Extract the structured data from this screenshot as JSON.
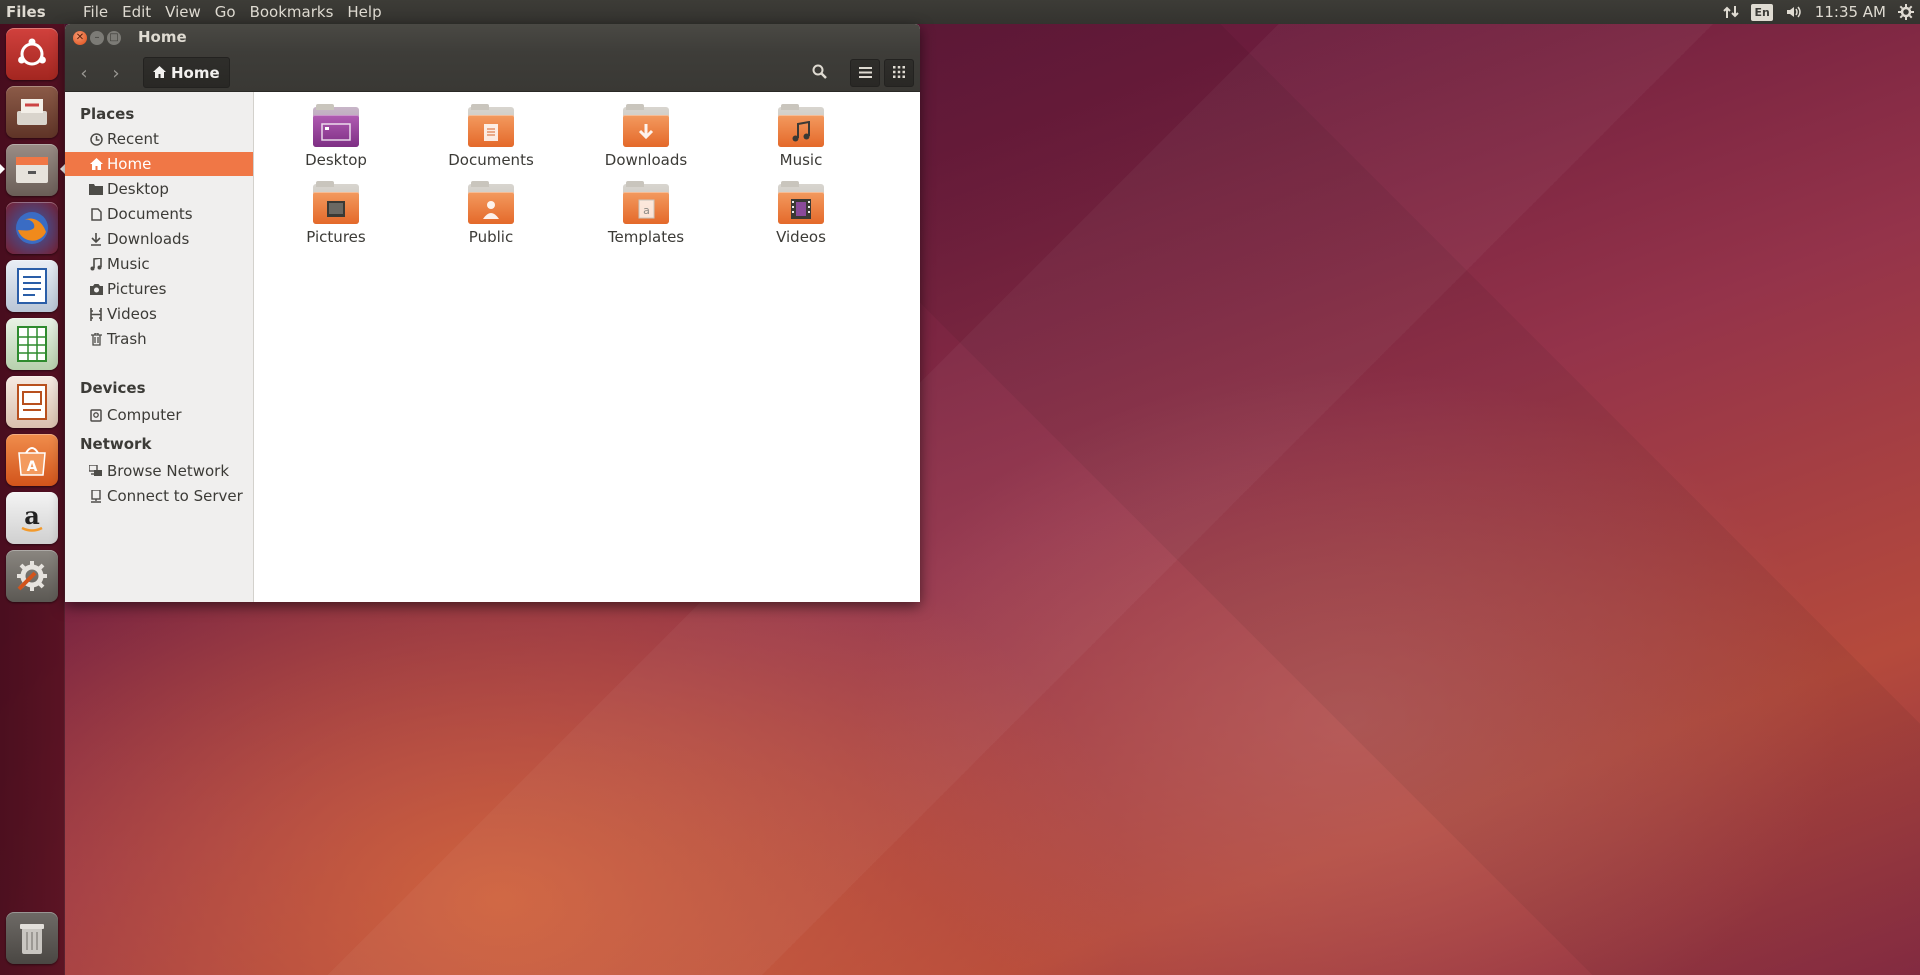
{
  "topbar": {
    "app_name": "Files",
    "menu": [
      "File",
      "Edit",
      "View",
      "Go",
      "Bookmarks",
      "Help"
    ],
    "keyboard_layout": "En",
    "clock": "11:35 AM"
  },
  "launcher": {
    "icons": [
      "ubuntu-dash-icon",
      "system-installer-icon",
      "files-icon",
      "firefox-icon",
      "libreoffice-writer-icon",
      "libreoffice-calc-icon",
      "libreoffice-impress-icon",
      "ubuntu-software-center-icon",
      "amazon-icon",
      "system-settings-icon",
      "trash-icon"
    ]
  },
  "window": {
    "title": "Home",
    "path_button": "Home"
  },
  "sidebar": {
    "places_header": "Places",
    "places": [
      {
        "label": "Recent",
        "icon": "clock-icon"
      },
      {
        "label": "Home",
        "icon": "home-icon",
        "active": true
      },
      {
        "label": "Desktop",
        "icon": "folder-icon"
      },
      {
        "label": "Documents",
        "icon": "document-icon"
      },
      {
        "label": "Downloads",
        "icon": "download-icon"
      },
      {
        "label": "Music",
        "icon": "music-icon"
      },
      {
        "label": "Pictures",
        "icon": "camera-icon"
      },
      {
        "label": "Videos",
        "icon": "film-icon"
      },
      {
        "label": "Trash",
        "icon": "trash-icon"
      }
    ],
    "devices_header": "Devices",
    "devices": [
      {
        "label": "Computer",
        "icon": "computer-icon"
      }
    ],
    "network_header": "Network",
    "network": [
      {
        "label": "Browse Network",
        "icon": "network-icon"
      },
      {
        "label": "Connect to Server",
        "icon": "server-icon"
      }
    ]
  },
  "files": [
    {
      "name": "Desktop"
    },
    {
      "name": "Documents"
    },
    {
      "name": "Downloads"
    },
    {
      "name": "Music"
    },
    {
      "name": "Pictures"
    },
    {
      "name": "Public"
    },
    {
      "name": "Templates"
    },
    {
      "name": "Videos"
    }
  ],
  "colors": {
    "accent": "#f07746",
    "panel": "#3c3b37",
    "launcher": "#4a0f20"
  }
}
